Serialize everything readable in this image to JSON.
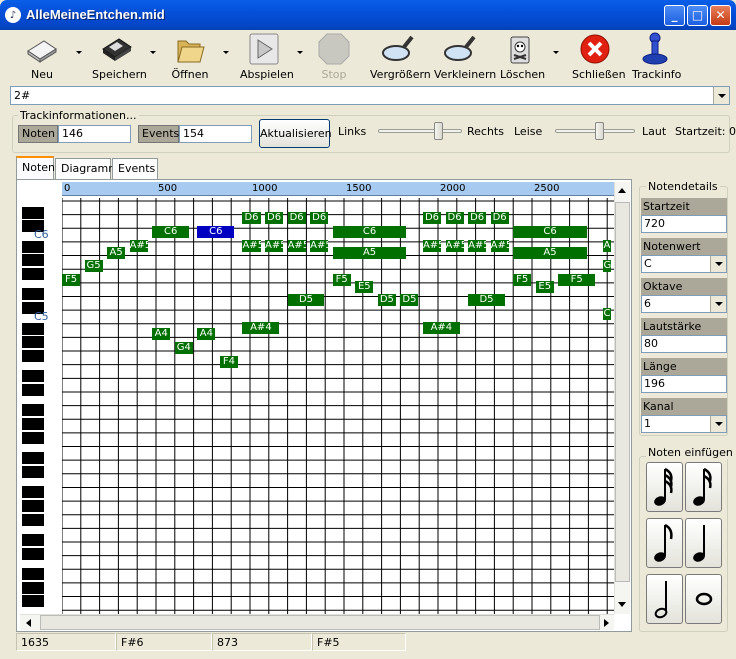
{
  "window": {
    "title": "AlleMeineEntchen.mid",
    "icon": "music-icon"
  },
  "toolbar": {
    "new": "Neu",
    "save": "Speichern",
    "open": "Öffnen",
    "play": "Abspielen",
    "stop": "Stop",
    "zoom_in": "Vergrößern",
    "zoom_out": "Verkleinern",
    "delete": "Löschen",
    "close": "Schließen",
    "trackinfo": "Trackinfo"
  },
  "track_combo": {
    "value": "2#"
  },
  "trackinfo": {
    "legend": "Trackinformationen...",
    "notes_label": "Noten",
    "notes_value": "146",
    "events_label": "Events",
    "events_value": "154",
    "update_button": "Aktualisieren",
    "pan_left": "Links",
    "pan_right": "Rechts",
    "vol_low": "Leise",
    "vol_high": "Laut",
    "start_time": "Startzeit: 0",
    "pan_level": 0.72,
    "volume_level": 0.55
  },
  "tabs": [
    "Noten",
    "Diagramm",
    "Events"
  ],
  "active_tab": "Noten",
  "ruler": {
    "labels": [
      "0",
      "500",
      "1000",
      "1500",
      "2000",
      "2500"
    ]
  },
  "keys": {
    "c6": "C6",
    "c5": "C5"
  },
  "notes": [
    {
      "label": "D6",
      "t": 960,
      "len": 96
    },
    {
      "label": "D6",
      "t": 1080,
      "len": 96
    },
    {
      "label": "D6",
      "t": 1200,
      "len": 96
    },
    {
      "label": "D6",
      "t": 1320,
      "len": 96
    },
    {
      "label": "D6",
      "t": 1920,
      "len": 96
    },
    {
      "label": "D6",
      "t": 2040,
      "len": 96
    },
    {
      "label": "D6",
      "t": 2160,
      "len": 96
    },
    {
      "label": "D6",
      "t": 2280,
      "len": 96
    },
    {
      "label": "C6",
      "t": 480,
      "len": 196
    },
    {
      "label": "C6",
      "t": 720,
      "len": 196,
      "selected": true
    },
    {
      "label": "C6",
      "t": 1440,
      "len": 392
    },
    {
      "label": "C6",
      "t": 2400,
      "len": 392
    },
    {
      "label": "A#5",
      "t": 360,
      "len": 96
    },
    {
      "label": "A#5",
      "t": 960,
      "len": 96
    },
    {
      "label": "A#5",
      "t": 1080,
      "len": 96
    },
    {
      "label": "A#5",
      "t": 1200,
      "len": 96
    },
    {
      "label": "A#5",
      "t": 1320,
      "len": 96
    },
    {
      "label": "A#5",
      "t": 1920,
      "len": 96
    },
    {
      "label": "A#5",
      "t": 2040,
      "len": 96
    },
    {
      "label": "A#5",
      "t": 2160,
      "len": 96
    },
    {
      "label": "A#5",
      "t": 2280,
      "len": 96
    },
    {
      "label": "A#5",
      "t": 2880,
      "len": 40
    },
    {
      "label": "A5",
      "t": 240,
      "len": 96
    },
    {
      "label": "A5",
      "t": 1440,
      "len": 392
    },
    {
      "label": "A5",
      "t": 2400,
      "len": 392
    },
    {
      "label": "G5",
      "t": 120,
      "len": 96
    },
    {
      "label": "G5",
      "t": 2880,
      "len": 40
    },
    {
      "label": "F5",
      "t": 0,
      "len": 96
    },
    {
      "label": "F5",
      "t": 1440,
      "len": 96
    },
    {
      "label": "F5",
      "t": 2400,
      "len": 96
    },
    {
      "label": "F5",
      "t": 2640,
      "len": 196
    },
    {
      "label": "E5",
      "t": 1560,
      "len": 96
    },
    {
      "label": "E5",
      "t": 2520,
      "len": 96
    },
    {
      "label": "D5",
      "t": 1200,
      "len": 196
    },
    {
      "label": "D5",
      "t": 1680,
      "len": 96
    },
    {
      "label": "D5",
      "t": 1800,
      "len": 96
    },
    {
      "label": "D5",
      "t": 2160,
      "len": 196
    },
    {
      "label": "C5",
      "t": 2880,
      "len": 40
    },
    {
      "label": "A#4",
      "t": 960,
      "len": 196
    },
    {
      "label": "A#4",
      "t": 1920,
      "len": 196
    },
    {
      "label": "A4",
      "t": 480,
      "len": 96
    },
    {
      "label": "A4",
      "t": 720,
      "len": 96
    },
    {
      "label": "G4",
      "t": 600,
      "len": 96
    },
    {
      "label": "F4",
      "t": 840,
      "len": 96
    }
  ],
  "statusbar": [
    "1635",
    "F#6",
    "873",
    "F#5"
  ],
  "details": {
    "legend": "Notendetails",
    "start_label": "Startzeit",
    "start_value": "720",
    "value_label": "Notenwert",
    "value_value": "C",
    "octave_label": "Oktave",
    "octave_value": "6",
    "volume_label": "Lautstärke",
    "volume_value": "80",
    "length_label": "Länge",
    "length_value": "196",
    "channel_label": "Kanal",
    "channel_value": "1"
  },
  "insert": {
    "legend": "Noten einfügen",
    "buttons": [
      "sixty-fourth-note-icon",
      "thirty-second-note-icon",
      "eighth-note-icon",
      "quarter-note-icon",
      "half-note-icon",
      "whole-note-icon"
    ]
  },
  "colors": {
    "note": "#007000",
    "selected_note": "#0000c0",
    "ruler": "#a6caf0",
    "title_bar": "#0a5ee8"
  }
}
